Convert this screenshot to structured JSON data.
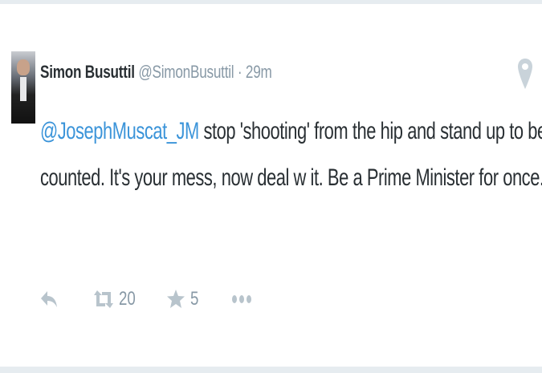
{
  "tweet": {
    "author_name": "Simon Busuttil",
    "author_handle": "@SimonBusuttil",
    "separator": "·",
    "time": "29m",
    "text_mention": "@JosephMuscat_JM",
    "text_line1_rest": " stop 'shooting' from the hip and stand up to be",
    "text_line2": "counted. It's your mess, now deal w it. Be a Prime Minister for once."
  },
  "actions": {
    "reply_icon": "reply-icon",
    "retweet_icon": "retweet-icon",
    "retweet_count": "20",
    "favorite_icon": "star-icon",
    "favorite_count": "5",
    "more_icon": "more-icon"
  },
  "colors": {
    "mention": "#3b94d9",
    "text": "#292f33",
    "muted": "#8899a6",
    "icon": "#b8c4cc"
  }
}
